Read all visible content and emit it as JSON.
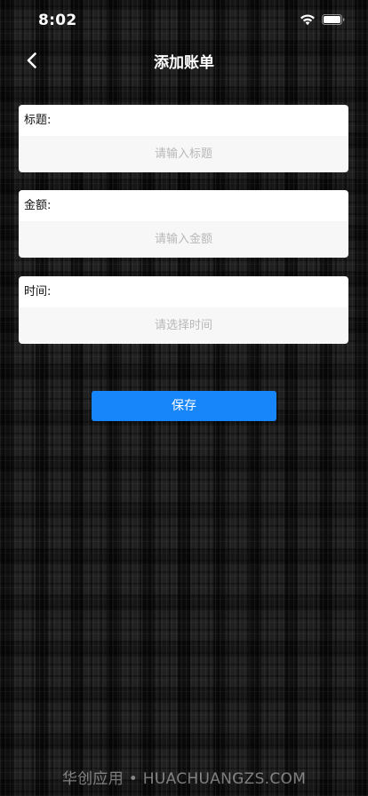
{
  "status_bar": {
    "time": "8:02"
  },
  "nav": {
    "title": "添加账单",
    "back_icon": "chevron-left-icon"
  },
  "form": {
    "title_field": {
      "label": "标题:",
      "placeholder": "请输入标题",
      "value": ""
    },
    "amount_field": {
      "label": "金额:",
      "placeholder": "请输入金额",
      "value": ""
    },
    "time_field": {
      "label": "时间:",
      "placeholder": "请选择时间"
    }
  },
  "actions": {
    "save_label": "保存"
  },
  "watermark": {
    "text": "华创应用 • HUACHUANGZS.COM"
  },
  "colors": {
    "accent": "#1786fb",
    "background": "#141414",
    "card_label_bg": "#ffffff",
    "card_input_bg": "#f7f7f7",
    "placeholder": "#b8b8b8"
  }
}
